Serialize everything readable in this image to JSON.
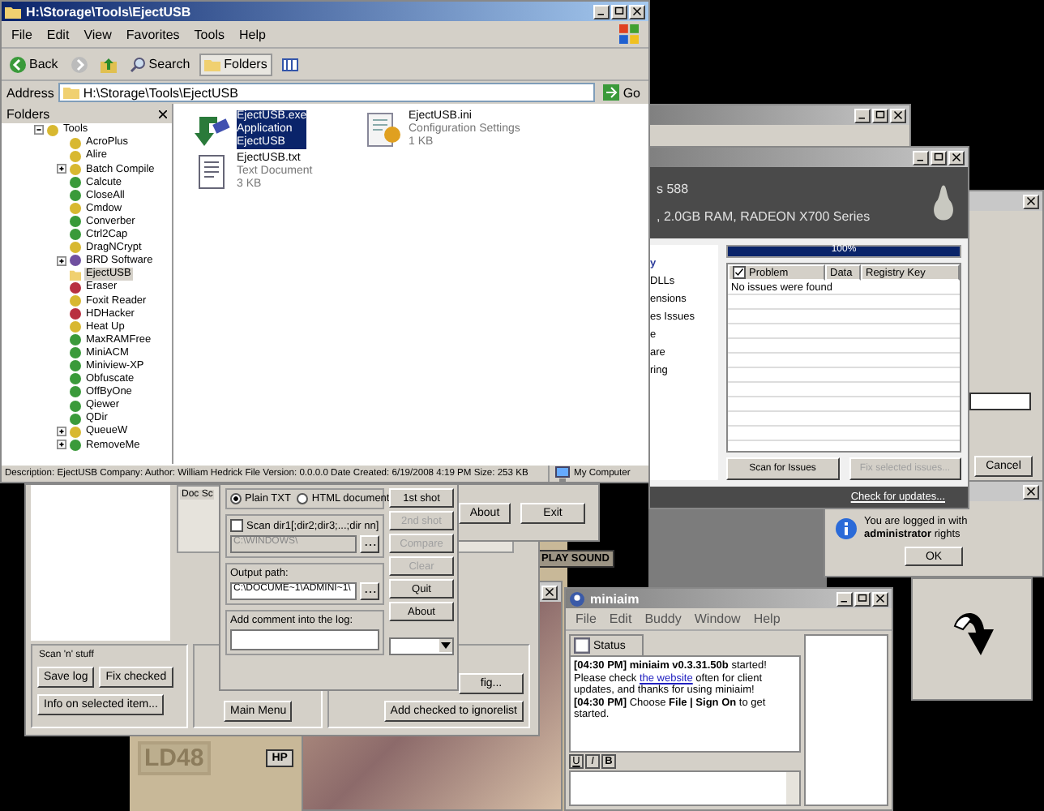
{
  "explorer": {
    "title": "H:\\Storage\\Tools\\EjectUSB",
    "menu": [
      "File",
      "Edit",
      "View",
      "Favorites",
      "Tools",
      "Help"
    ],
    "toolbar": {
      "back": "Back",
      "search": "Search",
      "folders": "Folders"
    },
    "address": {
      "label": "Address",
      "value": "H:\\Storage\\Tools\\EjectUSB",
      "go": "Go"
    },
    "folders_title": "Folders",
    "tree": [
      {
        "label": "Tools",
        "color": "#d8b830",
        "kind": "shield",
        "expandable": true,
        "selected": false,
        "children": [
          {
            "label": "AcroPlus",
            "color": "#d8b830",
            "kind": "shield",
            "expandable": false,
            "selected": false
          },
          {
            "label": "Alire",
            "color": "#d8b830",
            "kind": "shield",
            "expandable": false,
            "selected": false
          },
          {
            "label": "Batch Compile",
            "color": "#d8b830",
            "kind": "shield",
            "expandable": true,
            "selected": false
          },
          {
            "label": "Calcute",
            "color": "#3a9a3a",
            "kind": "shield",
            "expandable": false,
            "selected": false
          },
          {
            "label": "CloseAll",
            "color": "#3a9a3a",
            "kind": "shield",
            "expandable": false,
            "selected": false
          },
          {
            "label": "Cmdow",
            "color": "#d8b830",
            "kind": "shield",
            "expandable": false,
            "selected": false
          },
          {
            "label": "Converber",
            "color": "#3a9a3a",
            "kind": "shield",
            "expandable": false,
            "selected": false
          },
          {
            "label": "Ctrl2Cap",
            "color": "#3a9a3a",
            "kind": "shield",
            "expandable": false,
            "selected": false
          },
          {
            "label": "DragNCrypt",
            "color": "#d8b830",
            "kind": "shield",
            "expandable": false,
            "selected": false
          },
          {
            "label": "BRD Software",
            "color": "#7050a0",
            "kind": "shield",
            "expandable": true,
            "selected": false
          },
          {
            "label": "EjectUSB",
            "color": "#f0d070",
            "kind": "folder",
            "expandable": false,
            "selected": true
          },
          {
            "label": "Eraser",
            "color": "#b83040",
            "kind": "shield",
            "expandable": false,
            "selected": false
          },
          {
            "label": "Foxit Reader",
            "color": "#d8b830",
            "kind": "shield",
            "expandable": false,
            "selected": false
          },
          {
            "label": "HDHacker",
            "color": "#b83040",
            "kind": "shield",
            "expandable": false,
            "selected": false
          },
          {
            "label": "Heat Up",
            "color": "#d8b830",
            "kind": "shield",
            "expandable": false,
            "selected": false
          },
          {
            "label": "MaxRAMFree",
            "color": "#3a9a3a",
            "kind": "shield",
            "expandable": false,
            "selected": false
          },
          {
            "label": "MiniACM",
            "color": "#3a9a3a",
            "kind": "shield",
            "expandable": false,
            "selected": false
          },
          {
            "label": "Miniview-XP",
            "color": "#3a9a3a",
            "kind": "shield",
            "expandable": false,
            "selected": false
          },
          {
            "label": "Obfuscate",
            "color": "#3a9a3a",
            "kind": "shield",
            "expandable": false,
            "selected": false
          },
          {
            "label": "OffByOne",
            "color": "#3a9a3a",
            "kind": "shield",
            "expandable": false,
            "selected": false
          },
          {
            "label": "Qiewer",
            "color": "#3a9a3a",
            "kind": "shield",
            "expandable": false,
            "selected": false
          },
          {
            "label": "QDir",
            "color": "#3a9a3a",
            "kind": "shield",
            "expandable": false,
            "selected": false
          },
          {
            "label": "QueueW",
            "color": "#d8b830",
            "kind": "shield",
            "expandable": true,
            "selected": false
          },
          {
            "label": "RemoveMe",
            "color": "#3a9a3a",
            "kind": "shield",
            "expandable": true,
            "selected": false
          }
        ]
      }
    ],
    "files": [
      {
        "name": "EjectUSB.exe",
        "type": "Application",
        "detail": "EjectUSB",
        "kind": "exe",
        "selected": true
      },
      {
        "name": "EjectUSB.ini",
        "type": "Configuration Settings",
        "detail": "1 KB",
        "kind": "ini",
        "selected": false
      },
      {
        "name": "EjectUSB.txt",
        "type": "Text Document",
        "detail": "3 KB",
        "kind": "txt",
        "selected": false
      }
    ],
    "status": {
      "description": "Description: EjectUSB Company: Author: William Hedrick File Version: 0.0.0.0 Date Created: 6/19/2008 4:19 PM Size: 253 KB",
      "zone": "My Computer"
    }
  },
  "cleaner": {
    "system_line_1": "s 588",
    "system_line_2": ", 2.0GB RAM, RADEON X700 Series",
    "categories": [
      {
        "label": "y",
        "kind": "heading"
      },
      {
        "label": "DLLs",
        "kind": "item"
      },
      {
        "label": "ensions",
        "kind": "item"
      },
      {
        "label": "es Issues",
        "kind": "item"
      },
      {
        "label": "e",
        "kind": "item"
      },
      {
        "label": "are",
        "kind": "item"
      },
      {
        "label": "ring",
        "kind": "item"
      }
    ],
    "progress": {
      "level": 1.0,
      "text": "100%"
    },
    "columns": [
      {
        "label": "Problem",
        "checked": true
      },
      {
        "label": "Data"
      },
      {
        "label": "Registry Key"
      }
    ],
    "rows": [
      "No issues were found"
    ],
    "buttons": [
      {
        "label": "Scan for Issues",
        "disabled": false
      },
      {
        "label": "Fix selected issues...",
        "disabled": true
      }
    ],
    "update_link": "Check for updates..."
  },
  "side_window": {
    "button": "Cancel"
  },
  "admin_dialog": {
    "message": "You are logged in with **administrator** rights",
    "button": "OK"
  },
  "game": {
    "play_sound": "PLAY SOUND",
    "level_label": "LD48",
    "hp_label": "HP"
  },
  "scanner": {
    "group_label": "Doc Sc",
    "about": "About",
    "exit": "Exit",
    "scan_group": "Scan 'n' stuff",
    "save_log": "Save log",
    "fix_checked": "Fix checked",
    "info": "Info on selected item...",
    "main_menu": "Main Menu",
    "config": "fig...",
    "ignore": "Add checked to ignorelist"
  },
  "scan_dialog": {
    "formats": [
      {
        "label": "Plain TXT",
        "selected": true
      },
      {
        "label": "HTML document",
        "selected": false
      }
    ],
    "scan_dirs": {
      "label": "Scan dir1[;dir2;dir3;...;dir nn]",
      "checked": false,
      "value": "C:\\WINDOWS\\"
    },
    "output_label": "Output path:",
    "output_value": "C:\\DOCUME~1\\ADMINI~1\\",
    "comment_label": "Add comment into the log:",
    "buttons": [
      {
        "label": "1st shot",
        "disabled": false
      },
      {
        "label": "2nd shot",
        "disabled": true
      },
      {
        "label": "Compare",
        "disabled": true
      },
      {
        "label": "Clear",
        "disabled": true
      },
      {
        "label": "Quit",
        "disabled": false
      },
      {
        "label": "About",
        "disabled": false
      }
    ]
  },
  "miniaim": {
    "title": "miniaim",
    "menu": [
      "File",
      "Edit",
      "Buddy",
      "Window",
      "Help"
    ],
    "tab": "Status",
    "log": [
      [
        {
          "kind": "text",
          "text": "**[04:30 PM] miniaim v0.3.31.50b** started! Please check "
        },
        {
          "kind": "link",
          "text": "the website"
        },
        {
          "kind": "text",
          "text": " often for client updates, and thanks for using miniaim!"
        }
      ],
      [
        {
          "kind": "text",
          "text": "**[04:30 PM]** Choose **File | Sign On** to get started."
        }
      ]
    ],
    "format_buttons": [
      "U",
      "I",
      "B"
    ]
  }
}
